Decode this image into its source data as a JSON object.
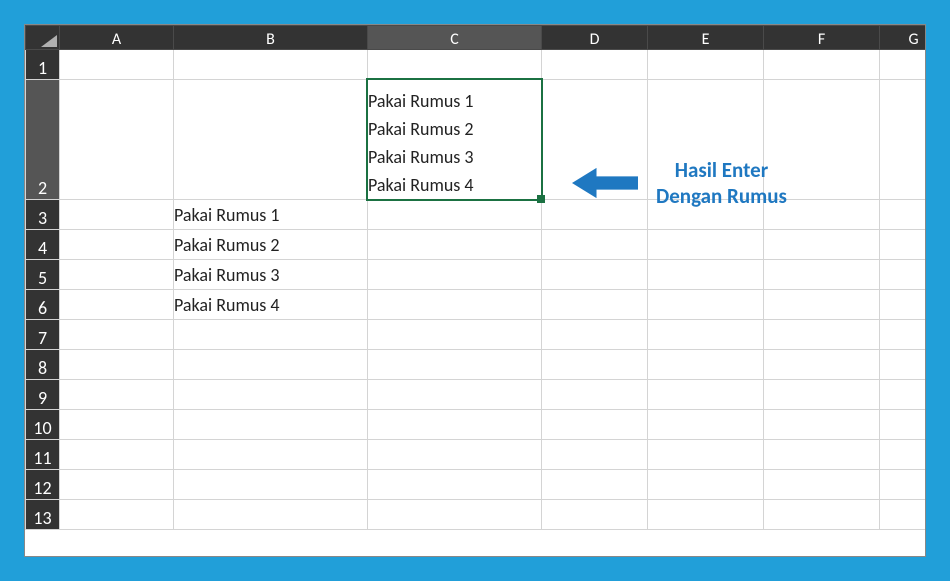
{
  "columns": [
    "A",
    "B",
    "C",
    "D",
    "E",
    "F",
    "G"
  ],
  "rows": [
    "1",
    "2",
    "3",
    "4",
    "5",
    "6",
    "7",
    "8",
    "9",
    "10",
    "11",
    "12",
    "13"
  ],
  "selected_col": "C",
  "selected_row": "2",
  "cells": {
    "C2_line1": "Pakai Rumus 1",
    "C2_line2": "Pakai Rumus 2",
    "C2_line3": "Pakai Rumus 3",
    "C2_line4": "Pakai Rumus 4",
    "B3": "Pakai Rumus 1",
    "B4": "Pakai Rumus 2",
    "B5": "Pakai Rumus 3",
    "B6": "Pakai Rumus 4"
  },
  "callout": {
    "line1": "Hasil Enter",
    "line2": "Dengan Rumus",
    "arrow_color": "#1f78c1"
  }
}
